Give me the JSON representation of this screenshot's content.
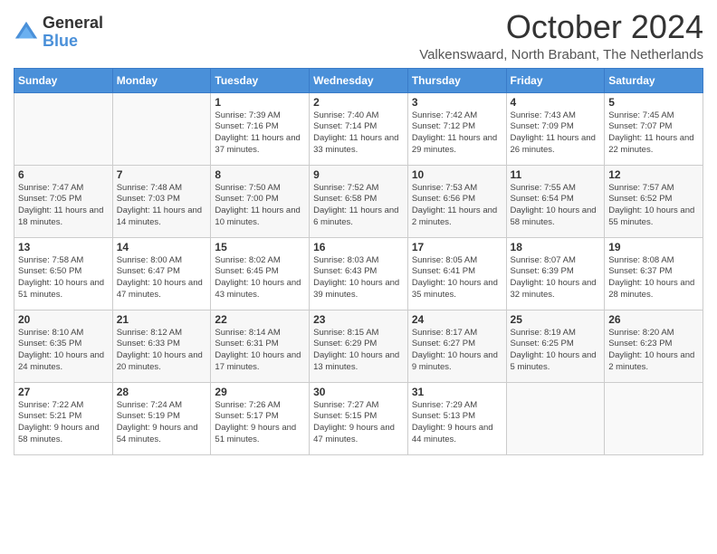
{
  "logo": {
    "general": "General",
    "blue": "Blue"
  },
  "title": "October 2024",
  "location": "Valkenswaard, North Brabant, The Netherlands",
  "days_of_week": [
    "Sunday",
    "Monday",
    "Tuesday",
    "Wednesday",
    "Thursday",
    "Friday",
    "Saturday"
  ],
  "weeks": [
    [
      {
        "day": "",
        "info": ""
      },
      {
        "day": "",
        "info": ""
      },
      {
        "day": "1",
        "info": "Sunrise: 7:39 AM\nSunset: 7:16 PM\nDaylight: 11 hours and 37 minutes."
      },
      {
        "day": "2",
        "info": "Sunrise: 7:40 AM\nSunset: 7:14 PM\nDaylight: 11 hours and 33 minutes."
      },
      {
        "day": "3",
        "info": "Sunrise: 7:42 AM\nSunset: 7:12 PM\nDaylight: 11 hours and 29 minutes."
      },
      {
        "day": "4",
        "info": "Sunrise: 7:43 AM\nSunset: 7:09 PM\nDaylight: 11 hours and 26 minutes."
      },
      {
        "day": "5",
        "info": "Sunrise: 7:45 AM\nSunset: 7:07 PM\nDaylight: 11 hours and 22 minutes."
      }
    ],
    [
      {
        "day": "6",
        "info": "Sunrise: 7:47 AM\nSunset: 7:05 PM\nDaylight: 11 hours and 18 minutes."
      },
      {
        "day": "7",
        "info": "Sunrise: 7:48 AM\nSunset: 7:03 PM\nDaylight: 11 hours and 14 minutes."
      },
      {
        "day": "8",
        "info": "Sunrise: 7:50 AM\nSunset: 7:00 PM\nDaylight: 11 hours and 10 minutes."
      },
      {
        "day": "9",
        "info": "Sunrise: 7:52 AM\nSunset: 6:58 PM\nDaylight: 11 hours and 6 minutes."
      },
      {
        "day": "10",
        "info": "Sunrise: 7:53 AM\nSunset: 6:56 PM\nDaylight: 11 hours and 2 minutes."
      },
      {
        "day": "11",
        "info": "Sunrise: 7:55 AM\nSunset: 6:54 PM\nDaylight: 10 hours and 58 minutes."
      },
      {
        "day": "12",
        "info": "Sunrise: 7:57 AM\nSunset: 6:52 PM\nDaylight: 10 hours and 55 minutes."
      }
    ],
    [
      {
        "day": "13",
        "info": "Sunrise: 7:58 AM\nSunset: 6:50 PM\nDaylight: 10 hours and 51 minutes."
      },
      {
        "day": "14",
        "info": "Sunrise: 8:00 AM\nSunset: 6:47 PM\nDaylight: 10 hours and 47 minutes."
      },
      {
        "day": "15",
        "info": "Sunrise: 8:02 AM\nSunset: 6:45 PM\nDaylight: 10 hours and 43 minutes."
      },
      {
        "day": "16",
        "info": "Sunrise: 8:03 AM\nSunset: 6:43 PM\nDaylight: 10 hours and 39 minutes."
      },
      {
        "day": "17",
        "info": "Sunrise: 8:05 AM\nSunset: 6:41 PM\nDaylight: 10 hours and 35 minutes."
      },
      {
        "day": "18",
        "info": "Sunrise: 8:07 AM\nSunset: 6:39 PM\nDaylight: 10 hours and 32 minutes."
      },
      {
        "day": "19",
        "info": "Sunrise: 8:08 AM\nSunset: 6:37 PM\nDaylight: 10 hours and 28 minutes."
      }
    ],
    [
      {
        "day": "20",
        "info": "Sunrise: 8:10 AM\nSunset: 6:35 PM\nDaylight: 10 hours and 24 minutes."
      },
      {
        "day": "21",
        "info": "Sunrise: 8:12 AM\nSunset: 6:33 PM\nDaylight: 10 hours and 20 minutes."
      },
      {
        "day": "22",
        "info": "Sunrise: 8:14 AM\nSunset: 6:31 PM\nDaylight: 10 hours and 17 minutes."
      },
      {
        "day": "23",
        "info": "Sunrise: 8:15 AM\nSunset: 6:29 PM\nDaylight: 10 hours and 13 minutes."
      },
      {
        "day": "24",
        "info": "Sunrise: 8:17 AM\nSunset: 6:27 PM\nDaylight: 10 hours and 9 minutes."
      },
      {
        "day": "25",
        "info": "Sunrise: 8:19 AM\nSunset: 6:25 PM\nDaylight: 10 hours and 5 minutes."
      },
      {
        "day": "26",
        "info": "Sunrise: 8:20 AM\nSunset: 6:23 PM\nDaylight: 10 hours and 2 minutes."
      }
    ],
    [
      {
        "day": "27",
        "info": "Sunrise: 7:22 AM\nSunset: 5:21 PM\nDaylight: 9 hours and 58 minutes."
      },
      {
        "day": "28",
        "info": "Sunrise: 7:24 AM\nSunset: 5:19 PM\nDaylight: 9 hours and 54 minutes."
      },
      {
        "day": "29",
        "info": "Sunrise: 7:26 AM\nSunset: 5:17 PM\nDaylight: 9 hours and 51 minutes."
      },
      {
        "day": "30",
        "info": "Sunrise: 7:27 AM\nSunset: 5:15 PM\nDaylight: 9 hours and 47 minutes."
      },
      {
        "day": "31",
        "info": "Sunrise: 7:29 AM\nSunset: 5:13 PM\nDaylight: 9 hours and 44 minutes."
      },
      {
        "day": "",
        "info": ""
      },
      {
        "day": "",
        "info": ""
      }
    ]
  ]
}
